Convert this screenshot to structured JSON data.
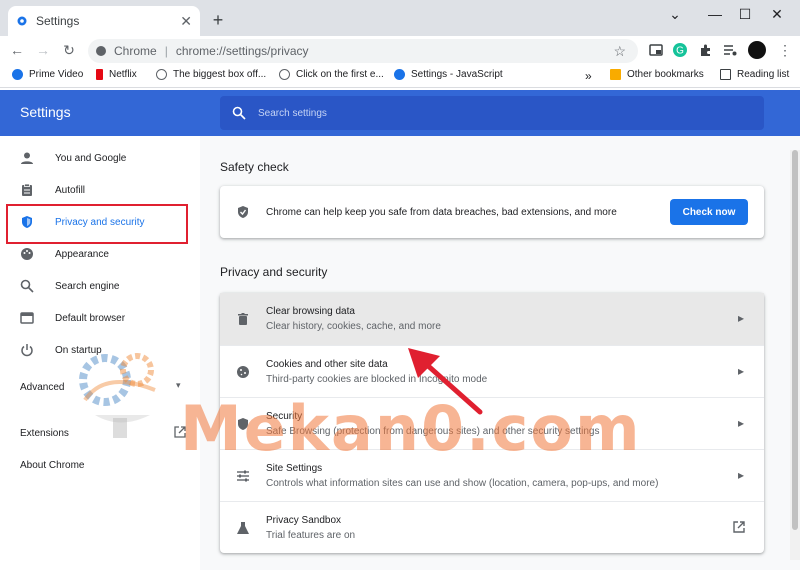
{
  "browser": {
    "tab_title": "Settings",
    "tab_close": "✕",
    "new_tab": "+",
    "window_controls": [
      "⌄",
      "—",
      "☐",
      "✕"
    ],
    "omnibox": {
      "site_label": "Chrome",
      "separator": "|",
      "url": "chrome://settings/privacy"
    },
    "bookmarks": [
      {
        "label": "Prime Video",
        "icon": "prime-video-icon",
        "color": "#1a73e8"
      },
      {
        "label": "Netflix",
        "icon": "netflix-icon",
        "color": "#e50914"
      },
      {
        "label": "The biggest box off...",
        "icon": "globe-icon",
        "color": "#5f6368"
      },
      {
        "label": "Click on the first e...",
        "icon": "globe-icon",
        "color": "#5f6368"
      },
      {
        "label": "Settings - JavaScript",
        "icon": "gear-icon",
        "color": "#1a73e8"
      }
    ],
    "bookmarks_overflow": "»",
    "other_bookmarks": "Other bookmarks",
    "reading_list": "Reading list"
  },
  "settings": {
    "title": "Settings",
    "search_placeholder": "Search settings",
    "accent": "#3367d6"
  },
  "sidebar": {
    "items": [
      {
        "label": "You and Google",
        "icon": "person-icon"
      },
      {
        "label": "Autofill",
        "icon": "clipboard-icon"
      },
      {
        "label": "Privacy and security",
        "icon": "shield-icon"
      },
      {
        "label": "Appearance",
        "icon": "palette-icon"
      },
      {
        "label": "Search engine",
        "icon": "search-icon"
      },
      {
        "label": "Default browser",
        "icon": "browser-icon"
      },
      {
        "label": "On startup",
        "icon": "power-icon"
      }
    ],
    "advanced": "Advanced",
    "extensions": "Extensions",
    "about": "About Chrome"
  },
  "main": {
    "safety_check": {
      "heading": "Safety check",
      "text": "Chrome can help keep you safe from data breaches, bad extensions, and more",
      "button": "Check now"
    },
    "privacy": {
      "heading": "Privacy and security",
      "rows": [
        {
          "title": "Clear browsing data",
          "subtitle": "Clear history, cookies, cache, and more",
          "icon": "trash-icon"
        },
        {
          "title": "Cookies and other site data",
          "subtitle": "Third-party cookies are blocked in Incognito mode",
          "icon": "cookie-icon"
        },
        {
          "title": "Security",
          "subtitle": "Safe Browsing (protection from dangerous sites) and other security settings",
          "icon": "shield-icon"
        },
        {
          "title": "Site Settings",
          "subtitle": "Controls what information sites can use and show (location, camera, pop-ups, and more)",
          "icon": "sliders-icon"
        },
        {
          "title": "Privacy Sandbox",
          "subtitle": "Trial features are on",
          "icon": "flask-icon"
        }
      ]
    }
  },
  "watermark": "Mekan0.com"
}
